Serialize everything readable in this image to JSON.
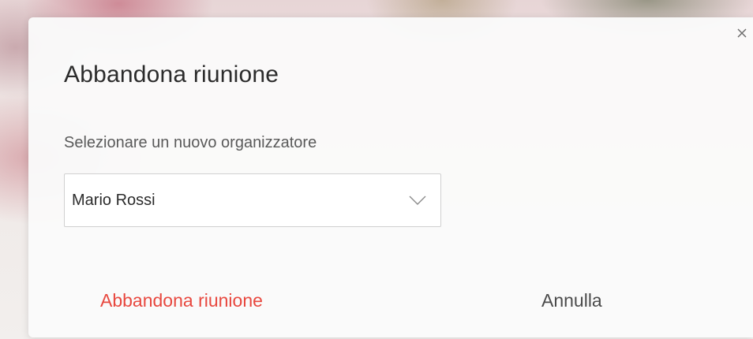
{
  "dialog": {
    "title": "Abbandona riunione",
    "close_icon": "close-icon",
    "organizer_label": "Selezionare un nuovo organizzatore",
    "organizer_select": {
      "selected_value": "Mario Rossi",
      "icon": "chevron-down-icon"
    },
    "primary_button_label": "Abbandona riunione",
    "cancel_button_label": "Annulla"
  },
  "colors": {
    "primary_button_text": "#e8483f",
    "cancel_button_text": "#4a4a4a",
    "title_text": "#2b2b2b"
  }
}
